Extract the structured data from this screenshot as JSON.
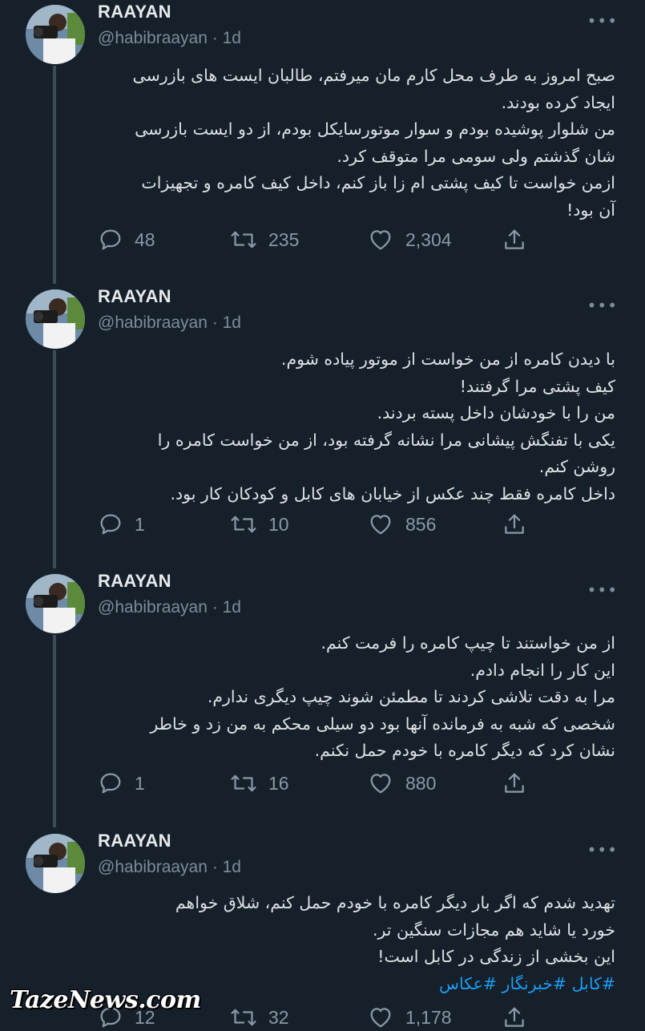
{
  "tweets": [
    {
      "name": "RAAYAN",
      "handle": "@habibraayan",
      "time": "· 1d",
      "more": "•••",
      "lines": [
        "صبح امروز به طرف محل کارم مان میرفتم، طالبان ایست های بازرسی",
        "ایجاد کرده بودند.",
        "من شلوار پوشیده بودم و سوار موتورسایکل بودم، از دو ایست بازرسی",
        "شان گذشتم ولی سومی مرا متوقف کرد.",
        "ازمن خواست تا کیف پشتی ام زا باز کنم، داخل کیف کامره و تجهیزات",
        "آن بود!"
      ],
      "replies": "48",
      "retweets": "235",
      "likes": "2,304"
    },
    {
      "name": "RAAYAN",
      "handle": "@habibraayan",
      "time": "· 1d",
      "more": "•••",
      "lines": [
        "با دیدن کامره از من خواست از موتور پیاده شوم.",
        "کیف پشتی مرا گرفتند!",
        "من را با خودشان داخل پسته بردند.",
        "یکی با تفنگش پیشانی مرا نشانه گرفته بود، از من خواست کامره را",
        "روشن کنم.",
        "داخل کامره فقط چند عکس از خیابان های کابل و کودکان کار بود."
      ],
      "replies": "1",
      "retweets": "10",
      "likes": "856"
    },
    {
      "name": "RAAYAN",
      "handle": "@habibraayan",
      "time": "· 1d",
      "more": "•••",
      "lines": [
        "از من خواستند تا چیپ کامره را فرمت کنم.",
        "این کار را انجام دادم.",
        "مرا به دقت تلاشی کردند تا مطمئن شوند چیپ دیگری ندارم.",
        "شخصی که شبه به فرمانده آنها بود دو سیلی محکم به من زد و خاطر",
        "نشان کرد که دیگر کامره با خودم حمل نکنم."
      ],
      "replies": "1",
      "retweets": "16",
      "likes": "880"
    },
    {
      "name": "RAAYAN",
      "handle": "@habibraayan",
      "time": "· 1d",
      "more": "•••",
      "lines": [
        "تهدید شدم که اگر بار دیگر کامره با خودم حمل کنم، شلاق خواهم",
        "خورد یا شاید هم مجازات سنگین تر.",
        "این بخشی از زندگی در کابل است!"
      ],
      "hashtags": "#کابل #خبرنگار #عکاس",
      "replies": "12",
      "retweets": "32",
      "likes": "1,178"
    }
  ],
  "watermark": "TazeNews.com",
  "colors": {
    "background": "#15202b",
    "text": "#dde1e4",
    "muted": "#8b98a5",
    "link": "#1d9bf0",
    "thread_line": "#3d4b57"
  },
  "icons": [
    "reply-icon",
    "retweet-icon",
    "like-icon",
    "share-icon",
    "more-icon"
  ]
}
